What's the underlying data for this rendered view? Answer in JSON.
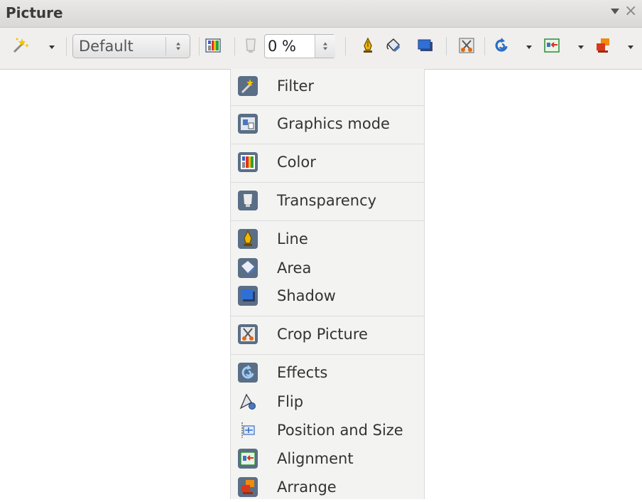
{
  "toolbar": {
    "title": "Picture",
    "mode_select": {
      "value": "Default"
    },
    "transparency": {
      "value": "0 %"
    }
  },
  "menu": {
    "items": [
      {
        "label": "Filter",
        "icon": "filter-icon"
      },
      {
        "label": "Graphics mode",
        "icon": "graphics-mode-icon"
      },
      {
        "label": "Color",
        "icon": "color-icon"
      },
      {
        "label": "Transparency",
        "icon": "transparency-icon"
      },
      {
        "label": "Line",
        "icon": "line-icon"
      },
      {
        "label": "Area",
        "icon": "area-icon"
      },
      {
        "label": "Shadow",
        "icon": "shadow-icon"
      },
      {
        "label": "Crop Picture",
        "icon": "crop-icon"
      },
      {
        "label": "Effects",
        "icon": "effects-icon"
      },
      {
        "label": "Flip",
        "icon": "flip-icon"
      },
      {
        "label": "Position and Size",
        "icon": "position-size-icon"
      },
      {
        "label": "Alignment",
        "icon": "alignment-icon"
      },
      {
        "label": "Arrange",
        "icon": "arrange-icon"
      }
    ]
  },
  "colors": {
    "toolbar_bg": "#f0efee",
    "menu_bg": "#f3f3f2",
    "icon_frame": "#5a6e86"
  }
}
